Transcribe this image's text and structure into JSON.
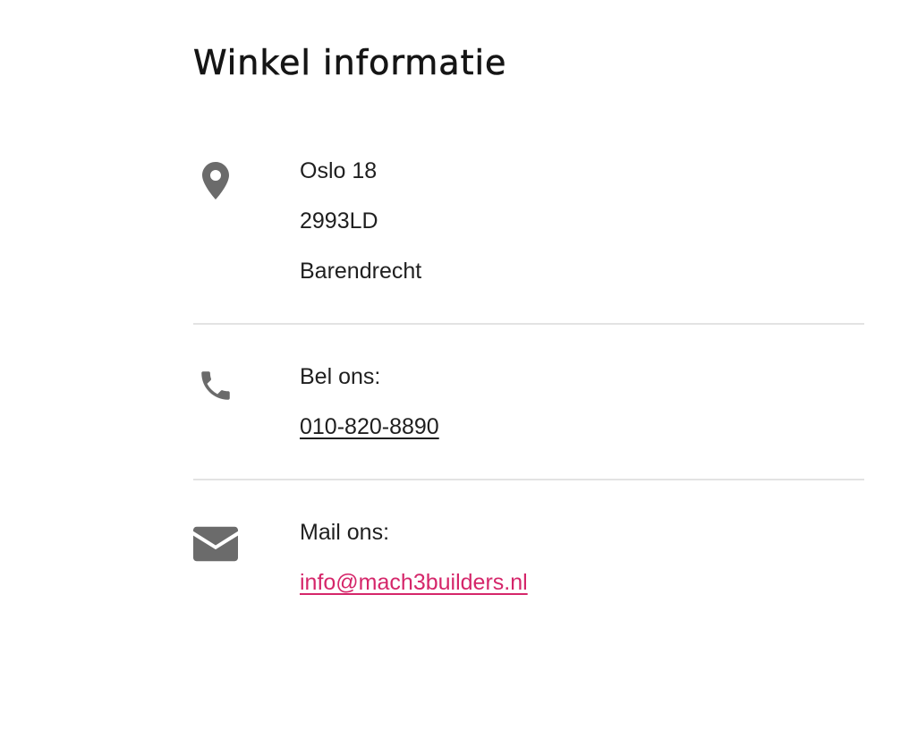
{
  "page": {
    "title": "Winkel informatie"
  },
  "address": {
    "icon": "map-pin-icon",
    "lines": [
      "Oslo 18",
      "2993LD",
      "Barendrecht"
    ]
  },
  "phone": {
    "icon": "phone-icon",
    "label": "Bel ons:",
    "number": "010-820-8890"
  },
  "mail": {
    "icon": "envelope-icon",
    "label": "Mail ons:",
    "address": "info@mach3builders.nl"
  },
  "colors": {
    "text": "#1f1f1f",
    "icon": "#6b6b6b",
    "link_accent": "#d5266a",
    "divider": "#e3e3e3"
  }
}
